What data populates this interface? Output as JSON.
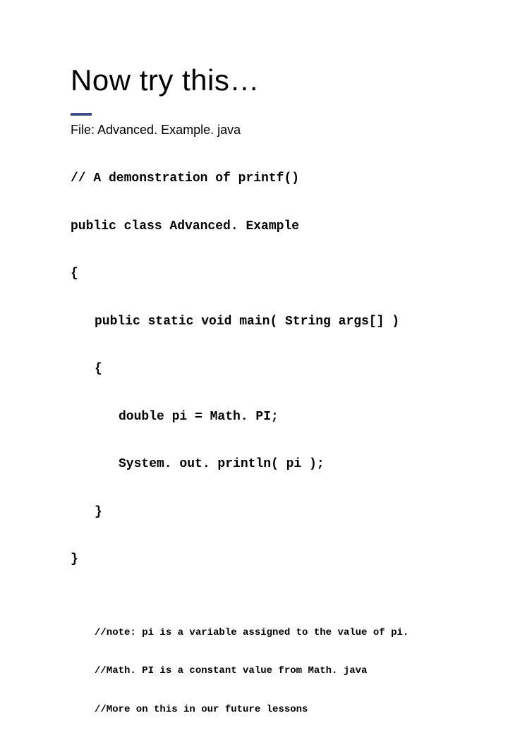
{
  "title": "Now try this…",
  "file_label": "File:  Advanced. Example. java",
  "code": {
    "l1": "// A demonstration of printf()",
    "l2": "public class Advanced. Example",
    "l3": "{",
    "l4": "public static void main( String args[] )",
    "l5": "{",
    "l6": "double pi = Math. PI;",
    "l7": "System. out. println( pi );",
    "l8": "}",
    "l9": "}"
  },
  "notes": {
    "n1": "//note: pi is a variable assigned to the value of pi.",
    "n2": "//Math. PI is a constant value from Math. java",
    "n3": "//More on this in our future lessons"
  }
}
